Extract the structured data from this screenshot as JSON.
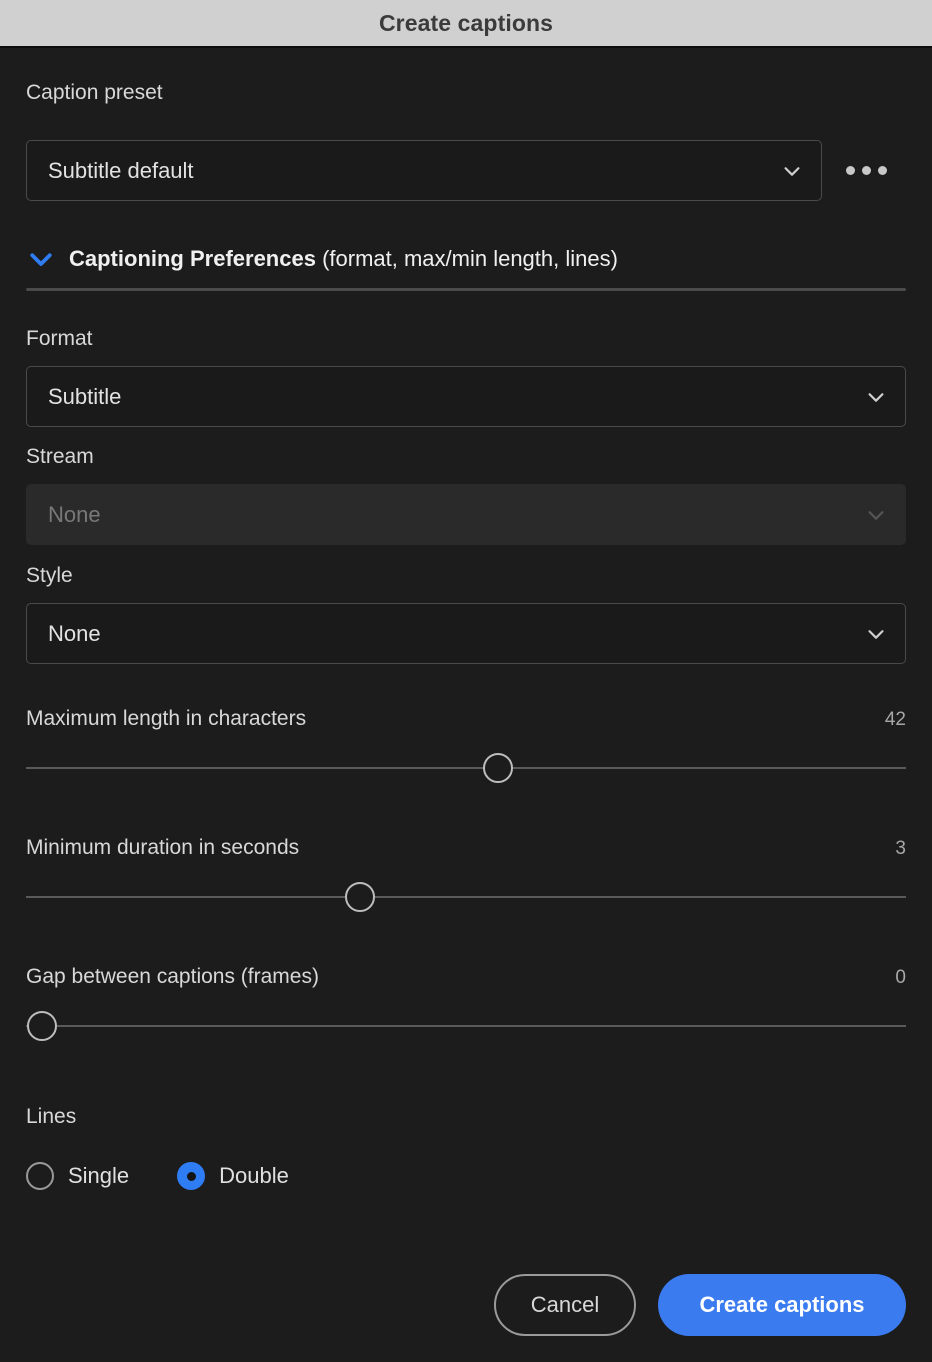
{
  "window": {
    "title": "Create captions"
  },
  "preset": {
    "label": "Caption preset",
    "value": "Subtitle default",
    "more_label": "..."
  },
  "preferences": {
    "title_bold": "Captioning Preferences",
    "title_rest": " (format, max/min length, lines)",
    "expanded": true
  },
  "format": {
    "label": "Format",
    "value": "Subtitle"
  },
  "stream": {
    "label": "Stream",
    "value": "None",
    "disabled": true
  },
  "style": {
    "label": "Style",
    "value": "None"
  },
  "sliders": [
    {
      "label": "Maximum length in characters",
      "value": "42",
      "percent": 53.6
    },
    {
      "label": "Minimum duration in seconds",
      "value": "3",
      "percent": 38.0
    },
    {
      "label": "Gap between captions (frames)",
      "value": "0",
      "percent": 1.8
    }
  ],
  "lines": {
    "label": "Lines",
    "options": [
      {
        "label": "Single",
        "selected": false
      },
      {
        "label": "Double",
        "selected": true
      }
    ]
  },
  "footer": {
    "cancel_label": "Cancel",
    "confirm_label": "Create captions"
  },
  "colors": {
    "accent": "#3a7bf4",
    "titlebar_bg": "#d0d0d0",
    "dialog_bg": "#1c1c1c",
    "field_bg": "#1a1a1a",
    "disabled_field_bg": "#2a2a2a"
  }
}
